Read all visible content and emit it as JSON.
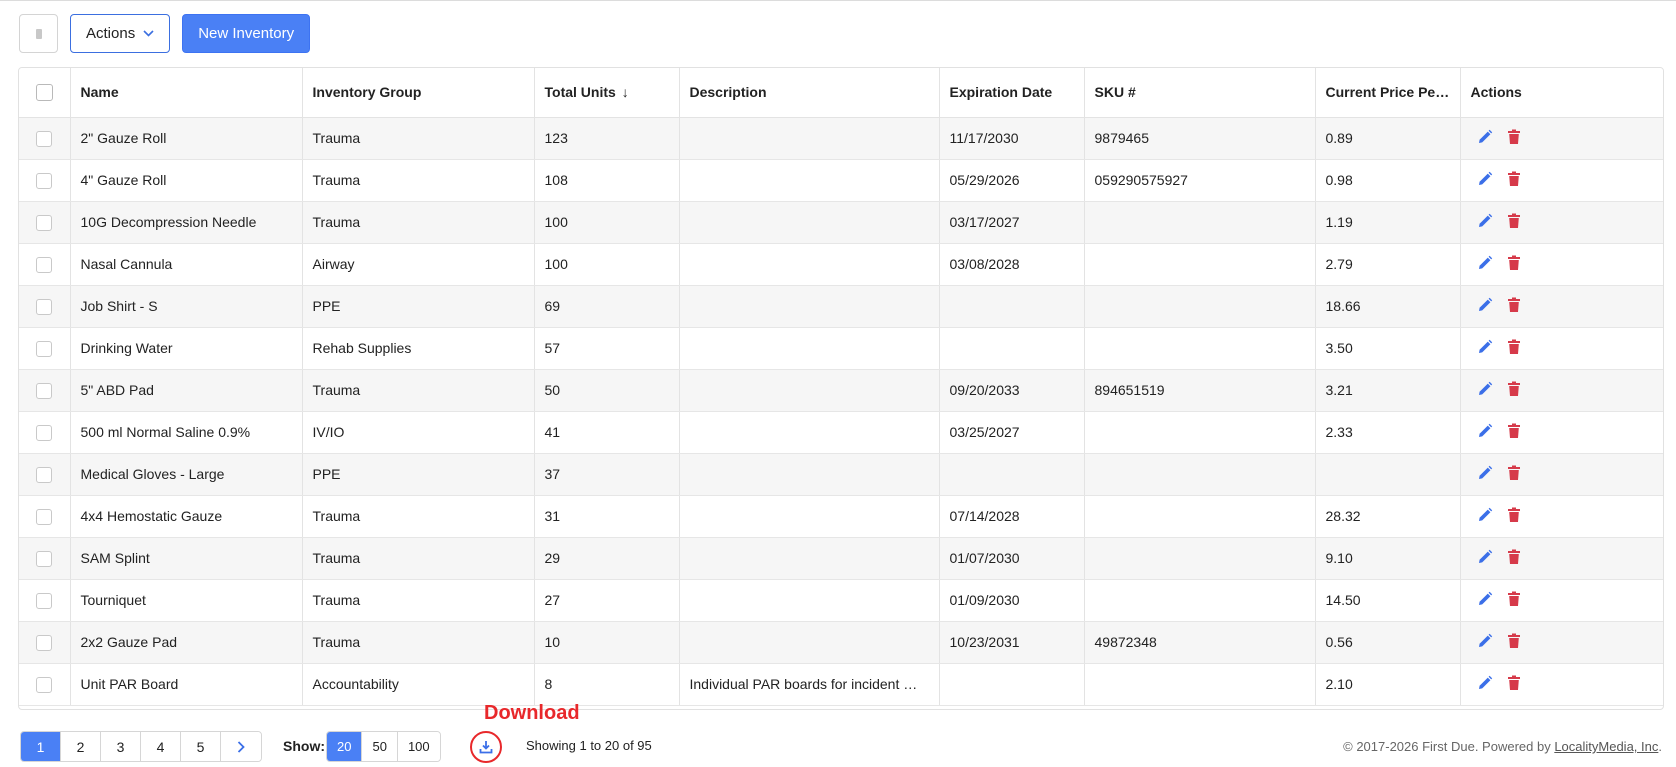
{
  "toolbar": {
    "actions_label": "Actions",
    "new_label": "New Inventory"
  },
  "table": {
    "columns": {
      "name": "Name",
      "group": "Inventory Group",
      "units": "Total Units",
      "units_sort": "↓",
      "description": "Description",
      "expiration": "Expiration Date",
      "sku": "SKU #",
      "price": "Current Price Per ...",
      "actions": "Actions"
    },
    "rows": [
      {
        "name": "2\" Gauze Roll",
        "group": "Trauma",
        "units": "123",
        "description": "",
        "expiration": "11/17/2030",
        "sku": "9879465",
        "price": "0.89"
      },
      {
        "name": "4\" Gauze Roll",
        "group": "Trauma",
        "units": "108",
        "description": "",
        "expiration": "05/29/2026",
        "sku": "059290575927",
        "price": "0.98"
      },
      {
        "name": "10G Decompression Needle",
        "group": "Trauma",
        "units": "100",
        "description": "",
        "expiration": "03/17/2027",
        "sku": "",
        "price": "1.19"
      },
      {
        "name": "Nasal Cannula",
        "group": "Airway",
        "units": "100",
        "description": "",
        "expiration": "03/08/2028",
        "sku": "",
        "price": "2.79"
      },
      {
        "name": "Job Shirt - S",
        "group": "PPE",
        "units": "69",
        "description": "",
        "expiration": "",
        "sku": "",
        "price": "18.66"
      },
      {
        "name": "Drinking Water",
        "group": "Rehab Supplies",
        "units": "57",
        "description": "",
        "expiration": "",
        "sku": "",
        "price": "3.50"
      },
      {
        "name": "5\" ABD Pad",
        "group": "Trauma",
        "units": "50",
        "description": "",
        "expiration": "09/20/2033",
        "sku": "894651519",
        "price": "3.21"
      },
      {
        "name": "500 ml Normal Saline 0.9%",
        "group": "IV/IO",
        "units": "41",
        "description": "",
        "expiration": "03/25/2027",
        "sku": "",
        "price": "2.33"
      },
      {
        "name": "Medical Gloves - Large",
        "group": "PPE",
        "units": "37",
        "description": "",
        "expiration": "",
        "sku": "",
        "price": ""
      },
      {
        "name": "4x4 Hemostatic Gauze",
        "group": "Trauma",
        "units": "31",
        "description": "",
        "expiration": "07/14/2028",
        "sku": "",
        "price": "28.32"
      },
      {
        "name": "SAM Splint",
        "group": "Trauma",
        "units": "29",
        "description": "",
        "expiration": "01/07/2030",
        "sku": "",
        "price": "9.10"
      },
      {
        "name": "Tourniquet",
        "group": "Trauma",
        "units": "27",
        "description": "",
        "expiration": "01/09/2030",
        "sku": "",
        "price": "14.50"
      },
      {
        "name": "2x2 Gauze Pad",
        "group": "Trauma",
        "units": "10",
        "description": "",
        "expiration": "10/23/2031",
        "sku": "49872348",
        "price": "0.56"
      },
      {
        "name": "Unit PAR Board",
        "group": "Accountability",
        "units": "8",
        "description": "Individual PAR boards for incident ma...",
        "expiration": "",
        "sku": "",
        "price": "2.10"
      }
    ]
  },
  "pagination": {
    "pages": [
      "1",
      "2",
      "3",
      "4",
      "5"
    ],
    "active_page": "1",
    "next_icon": "chevron-right-icon"
  },
  "show": {
    "label": "Show:",
    "options": [
      "20",
      "50",
      "100"
    ],
    "active": "20"
  },
  "download": {
    "label": "Download",
    "icon": "download-icon"
  },
  "showing_text": "Showing 1 to 20 of 95",
  "footer": {
    "copyright": "© 2017-2026 First Due. Powered by ",
    "link": "LocalityMedia, Inc",
    "suffix": "."
  },
  "colors": {
    "accent": "#4a80f5",
    "edit_icon": "#3b6fe8",
    "delete_icon": "#d63a4a",
    "highlight": "#e8282b"
  }
}
